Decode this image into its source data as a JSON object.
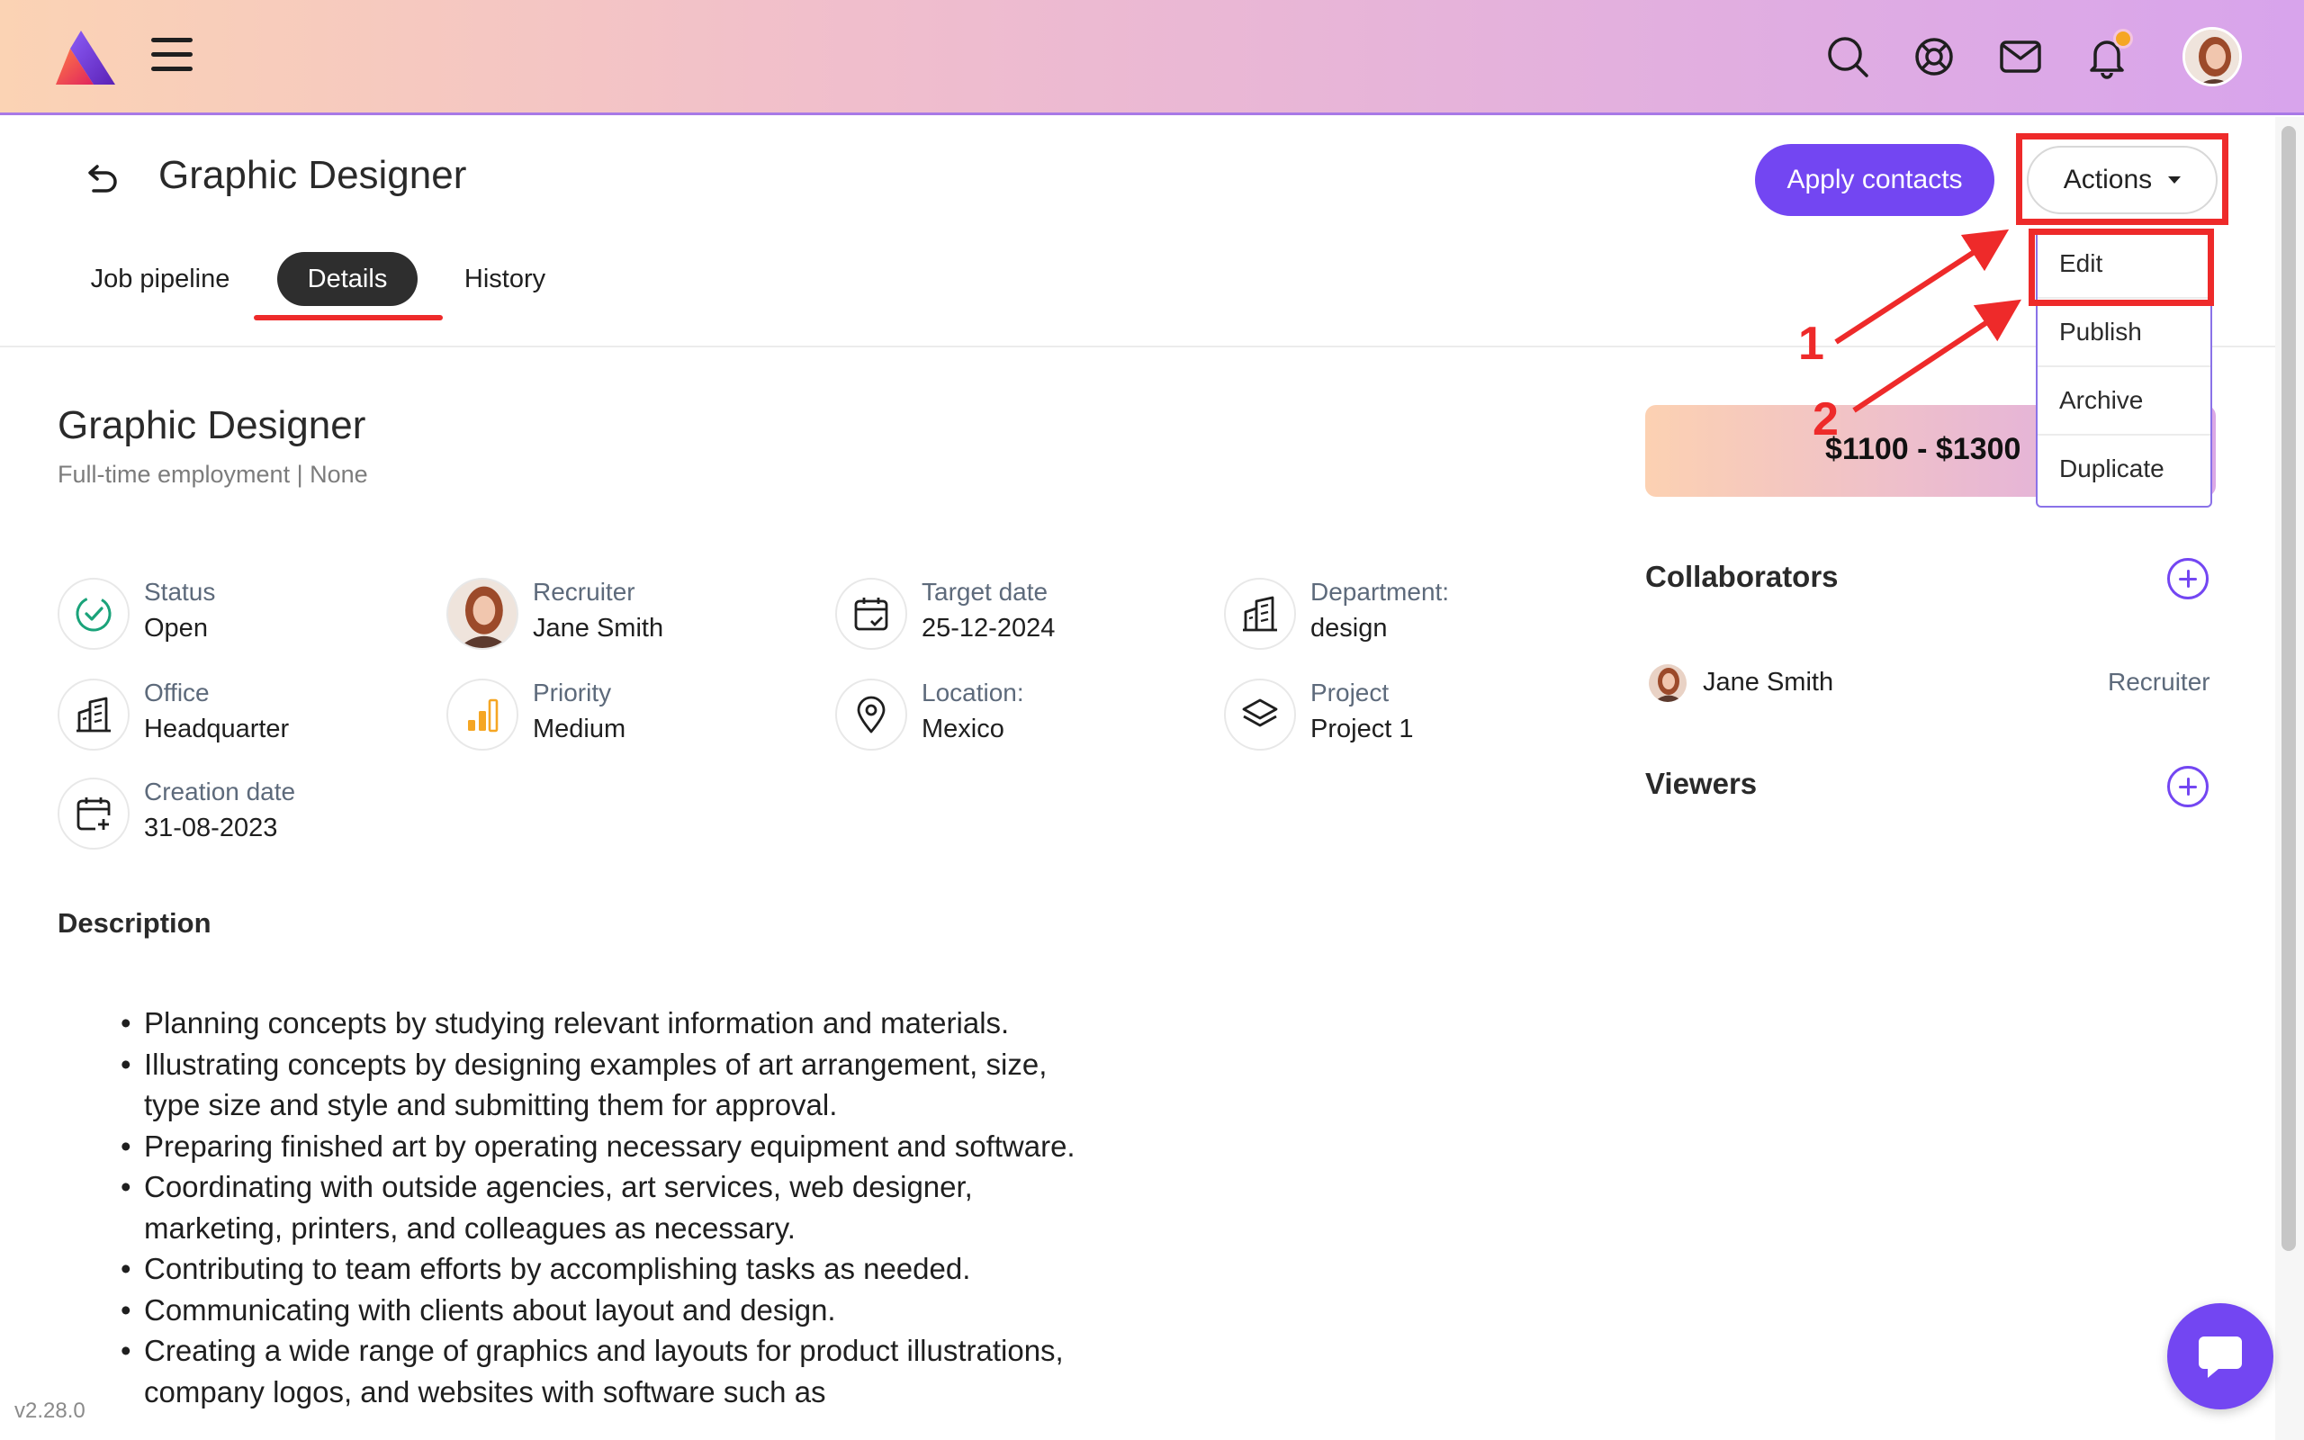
{
  "header": {
    "logo_icon": "app-logo",
    "menu_icon": "hamburger-icon",
    "icons": [
      "search-icon",
      "help-lifebuoy-icon",
      "mail-icon",
      "bell-icon"
    ],
    "notification_dot_color": "#f5a623",
    "avatar": "user-avatar"
  },
  "page": {
    "title": "Graphic Designer",
    "apply_contacts_label": "Apply contacts",
    "actions_label": "Actions",
    "actions_menu": [
      "Edit",
      "Publish",
      "Archive",
      "Duplicate"
    ],
    "tabs": [
      {
        "label": "Job pipeline",
        "active": false
      },
      {
        "label": "Details",
        "active": true
      },
      {
        "label": "History",
        "active": false
      }
    ]
  },
  "annotations": {
    "numbers": [
      "1",
      "2"
    ],
    "color": "#ee2a2a"
  },
  "job": {
    "title": "Graphic Designer",
    "subtitle": "Full-time employment | None",
    "fields": [
      {
        "label": "Status",
        "value": "Open",
        "icon": "status-check-icon"
      },
      {
        "label": "Recruiter",
        "value": "Jane Smith",
        "icon": "recruiter-avatar"
      },
      {
        "label": "Target date",
        "value": "25-12-2024",
        "icon": "calendar-check-icon"
      },
      {
        "label": "Department:",
        "value": "design",
        "icon": "building-icon"
      },
      {
        "label": "Office",
        "value": "Headquarter",
        "icon": "office-building-icon"
      },
      {
        "label": "Priority",
        "value": "Medium",
        "icon": "priority-bars-icon"
      },
      {
        "label": "Location:",
        "value": "Mexico",
        "icon": "location-pin-icon"
      },
      {
        "label": "Project",
        "value": "Project 1",
        "icon": "layers-icon"
      },
      {
        "label": "Creation date",
        "value": "31-08-2023",
        "icon": "calendar-plus-icon"
      }
    ],
    "description_title": "Description",
    "description_items": [
      "Planning concepts by studying relevant information and materials.",
      "Illustrating concepts by designing examples of art arrangement, size, type size and style and submitting them for approval.",
      "Preparing finished art by operating necessary equipment and software.",
      "Coordinating with outside agencies, art services, web designer, marketing, printers, and colleagues as necessary.",
      "Contributing to team efforts by accomplishing tasks as needed.",
      "Communicating with clients about layout and design.",
      "Creating a wide range of graphics and layouts for product illustrations, company logos, and websites with software such as"
    ]
  },
  "sidebar": {
    "salary": "$1100 - $1300",
    "collaborators_title": "Collaborators",
    "collaborators": [
      {
        "name": "Jane Smith",
        "role": "Recruiter"
      }
    ],
    "viewers_title": "Viewers"
  },
  "footer": {
    "version": "v2.28.0",
    "chat_icon": "chat-bubble-icon"
  },
  "colors": {
    "accent": "#7346f2",
    "tab_active_bg": "#2e2e2e",
    "priority_color": "#f5a623",
    "status_color": "#1aa37a"
  }
}
